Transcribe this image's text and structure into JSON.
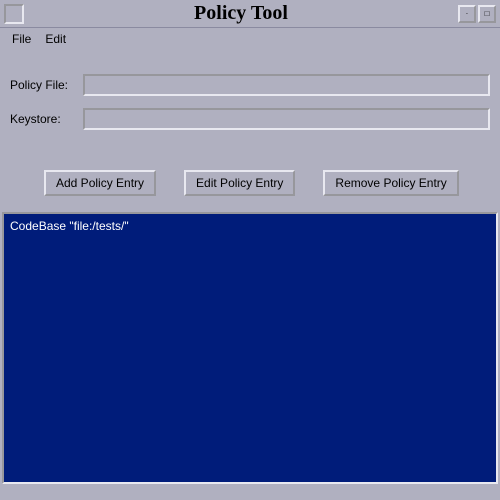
{
  "window": {
    "title": "Policy Tool"
  },
  "menu": {
    "file": "File",
    "edit": "Edit"
  },
  "form": {
    "policy_file_label": "Policy File:",
    "policy_file_value": "",
    "keystore_label": "Keystore:",
    "keystore_value": ""
  },
  "buttons": {
    "add": "Add Policy Entry",
    "edit": "Edit Policy Entry",
    "remove": "Remove Policy Entry"
  },
  "entries": {
    "items": [
      "CodeBase \"file:/tests/\""
    ]
  }
}
